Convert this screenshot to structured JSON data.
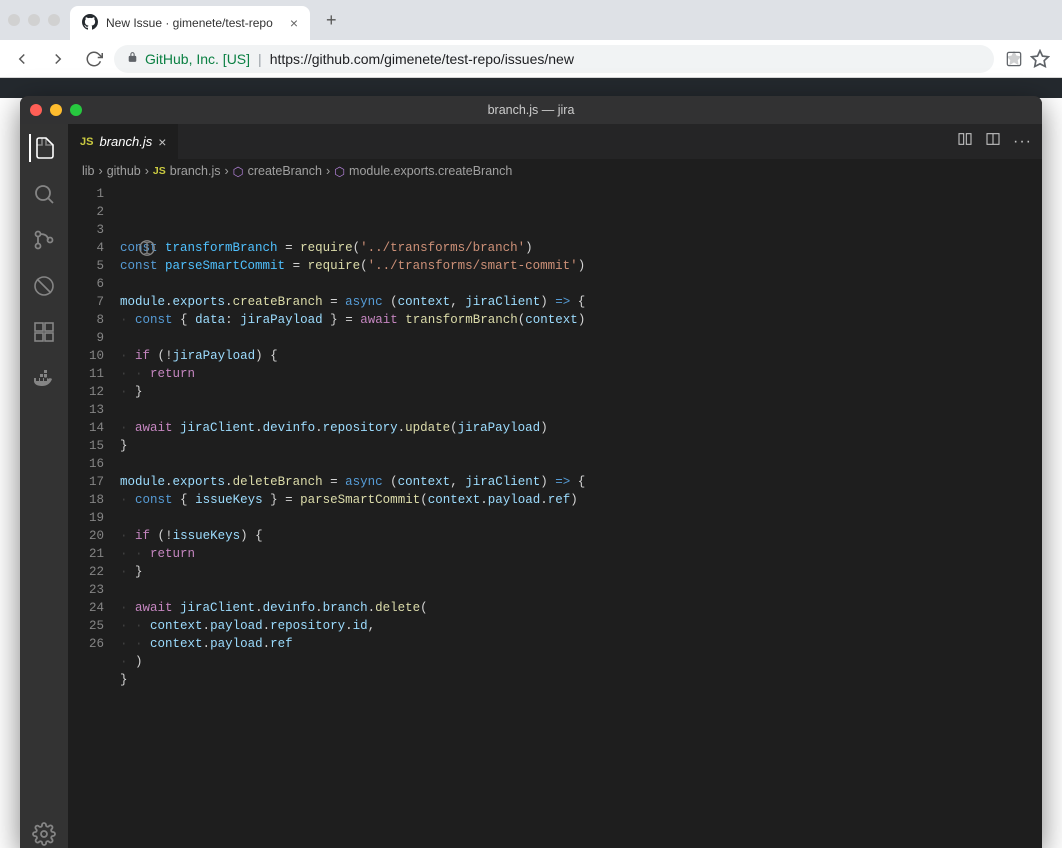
{
  "browser": {
    "tab_title": "New Issue · gimenete/test-repo",
    "url_secure_label": "GitHub, Inc. [US]",
    "url": "https://github.com/gimenete/test-repo/issues/new"
  },
  "editor": {
    "window_title": "branch.js — jira",
    "tab": {
      "badge": "JS",
      "filename": "branch.js"
    },
    "breadcrumbs": [
      "lib",
      "github",
      "branch.js",
      "createBranch",
      "module.exports.createBranch"
    ],
    "bc_badge_index": 2,
    "code_lines": [
      [
        [
          "kw",
          "const"
        ],
        [
          "sp",
          " "
        ],
        [
          "const",
          "transformBranch"
        ],
        [
          "sp",
          " "
        ],
        [
          "op",
          "="
        ],
        [
          "sp",
          " "
        ],
        [
          "fn",
          "require"
        ],
        [
          "op",
          "("
        ],
        [
          "str",
          "'../transforms/branch'"
        ],
        [
          "op",
          ")"
        ]
      ],
      [
        [
          "kw",
          "const"
        ],
        [
          "sp",
          " "
        ],
        [
          "const",
          "parseSmartCommit"
        ],
        [
          "sp",
          " "
        ],
        [
          "op",
          "="
        ],
        [
          "sp",
          " "
        ],
        [
          "fn",
          "require"
        ],
        [
          "op",
          "("
        ],
        [
          "str",
          "'../transforms/smart-commit'"
        ],
        [
          "op",
          ")"
        ]
      ],
      [],
      [
        [
          "var",
          "module"
        ],
        [
          "op",
          "."
        ],
        [
          "var",
          "exports"
        ],
        [
          "op",
          "."
        ],
        [
          "fn",
          "createBranch"
        ],
        [
          "sp",
          " "
        ],
        [
          "op",
          "="
        ],
        [
          "sp",
          " "
        ],
        [
          "kw",
          "async"
        ],
        [
          "sp",
          " "
        ],
        [
          "op",
          "("
        ],
        [
          "var",
          "context"
        ],
        [
          "op",
          ","
        ],
        [
          "sp",
          " "
        ],
        [
          "var",
          "jiraClient"
        ],
        [
          "op",
          ")"
        ],
        [
          "sp",
          " "
        ],
        [
          "kw",
          "=>"
        ],
        [
          "sp",
          " "
        ],
        [
          "op",
          "{"
        ]
      ],
      [
        [
          "dot",
          "·"
        ],
        [
          "kw",
          "const"
        ],
        [
          "sp",
          " "
        ],
        [
          "op",
          "{"
        ],
        [
          "sp",
          " "
        ],
        [
          "var",
          "data"
        ],
        [
          "op",
          ":"
        ],
        [
          "sp",
          " "
        ],
        [
          "var",
          "jiraPayload"
        ],
        [
          "sp",
          " "
        ],
        [
          "op",
          "}"
        ],
        [
          "sp",
          " "
        ],
        [
          "op",
          "="
        ],
        [
          "sp",
          " "
        ],
        [
          "ctl",
          "await"
        ],
        [
          "sp",
          " "
        ],
        [
          "fn",
          "transformBranch"
        ],
        [
          "op",
          "("
        ],
        [
          "var",
          "context"
        ],
        [
          "op",
          ")"
        ]
      ],
      [],
      [
        [
          "dot",
          "·"
        ],
        [
          "ctl",
          "if"
        ],
        [
          "sp",
          " "
        ],
        [
          "op",
          "("
        ],
        [
          "op",
          "!"
        ],
        [
          "var",
          "jiraPayload"
        ],
        [
          "op",
          ")"
        ],
        [
          "sp",
          " "
        ],
        [
          "op",
          "{"
        ]
      ],
      [
        [
          "dot",
          "··"
        ],
        [
          "ctl",
          "return"
        ]
      ],
      [
        [
          "dot",
          "·"
        ],
        [
          "op",
          "}"
        ]
      ],
      [],
      [
        [
          "dot",
          "·"
        ],
        [
          "ctl",
          "await"
        ],
        [
          "sp",
          " "
        ],
        [
          "var",
          "jiraClient"
        ],
        [
          "op",
          "."
        ],
        [
          "var",
          "devinfo"
        ],
        [
          "op",
          "."
        ],
        [
          "var",
          "repository"
        ],
        [
          "op",
          "."
        ],
        [
          "fn",
          "update"
        ],
        [
          "op",
          "("
        ],
        [
          "var",
          "jiraPayload"
        ],
        [
          "op",
          ")"
        ]
      ],
      [
        [
          "op",
          "}"
        ]
      ],
      [],
      [
        [
          "var",
          "module"
        ],
        [
          "op",
          "."
        ],
        [
          "var",
          "exports"
        ],
        [
          "op",
          "."
        ],
        [
          "fn",
          "deleteBranch"
        ],
        [
          "sp",
          " "
        ],
        [
          "op",
          "="
        ],
        [
          "sp",
          " "
        ],
        [
          "kw",
          "async"
        ],
        [
          "sp",
          " "
        ],
        [
          "op",
          "("
        ],
        [
          "var",
          "context"
        ],
        [
          "op",
          ","
        ],
        [
          "sp",
          " "
        ],
        [
          "var",
          "jiraClient"
        ],
        [
          "op",
          ")"
        ],
        [
          "sp",
          " "
        ],
        [
          "kw",
          "=>"
        ],
        [
          "sp",
          " "
        ],
        [
          "op",
          "{"
        ]
      ],
      [
        [
          "dot",
          "·"
        ],
        [
          "kw",
          "const"
        ],
        [
          "sp",
          " "
        ],
        [
          "op",
          "{"
        ],
        [
          "sp",
          " "
        ],
        [
          "var",
          "issueKeys"
        ],
        [
          "sp",
          " "
        ],
        [
          "op",
          "}"
        ],
        [
          "sp",
          " "
        ],
        [
          "op",
          "="
        ],
        [
          "sp",
          " "
        ],
        [
          "fn",
          "parseSmartCommit"
        ],
        [
          "op",
          "("
        ],
        [
          "var",
          "context"
        ],
        [
          "op",
          "."
        ],
        [
          "var",
          "payload"
        ],
        [
          "op",
          "."
        ],
        [
          "var",
          "ref"
        ],
        [
          "op",
          ")"
        ]
      ],
      [],
      [
        [
          "dot",
          "·"
        ],
        [
          "ctl",
          "if"
        ],
        [
          "sp",
          " "
        ],
        [
          "op",
          "("
        ],
        [
          "op",
          "!"
        ],
        [
          "var",
          "issueKeys"
        ],
        [
          "op",
          ")"
        ],
        [
          "sp",
          " "
        ],
        [
          "op",
          "{"
        ]
      ],
      [
        [
          "dot",
          "··"
        ],
        [
          "ctl",
          "return"
        ]
      ],
      [
        [
          "dot",
          "·"
        ],
        [
          "op",
          "}"
        ]
      ],
      [],
      [
        [
          "dot",
          "·"
        ],
        [
          "ctl",
          "await"
        ],
        [
          "sp",
          " "
        ],
        [
          "var",
          "jiraClient"
        ],
        [
          "op",
          "."
        ],
        [
          "var",
          "devinfo"
        ],
        [
          "op",
          "."
        ],
        [
          "var",
          "branch"
        ],
        [
          "op",
          "."
        ],
        [
          "fn",
          "delete"
        ],
        [
          "op",
          "("
        ]
      ],
      [
        [
          "dot",
          "··"
        ],
        [
          "var",
          "context"
        ],
        [
          "op",
          "."
        ],
        [
          "var",
          "payload"
        ],
        [
          "op",
          "."
        ],
        [
          "var",
          "repository"
        ],
        [
          "op",
          "."
        ],
        [
          "var",
          "id"
        ],
        [
          "op",
          ","
        ]
      ],
      [
        [
          "dot",
          "··"
        ],
        [
          "var",
          "context"
        ],
        [
          "op",
          "."
        ],
        [
          "var",
          "payload"
        ],
        [
          "op",
          "."
        ],
        [
          "var",
          "ref"
        ]
      ],
      [
        [
          "dot",
          "·"
        ],
        [
          "op",
          ")"
        ]
      ],
      [
        [
          "op",
          "}"
        ]
      ],
      []
    ]
  }
}
